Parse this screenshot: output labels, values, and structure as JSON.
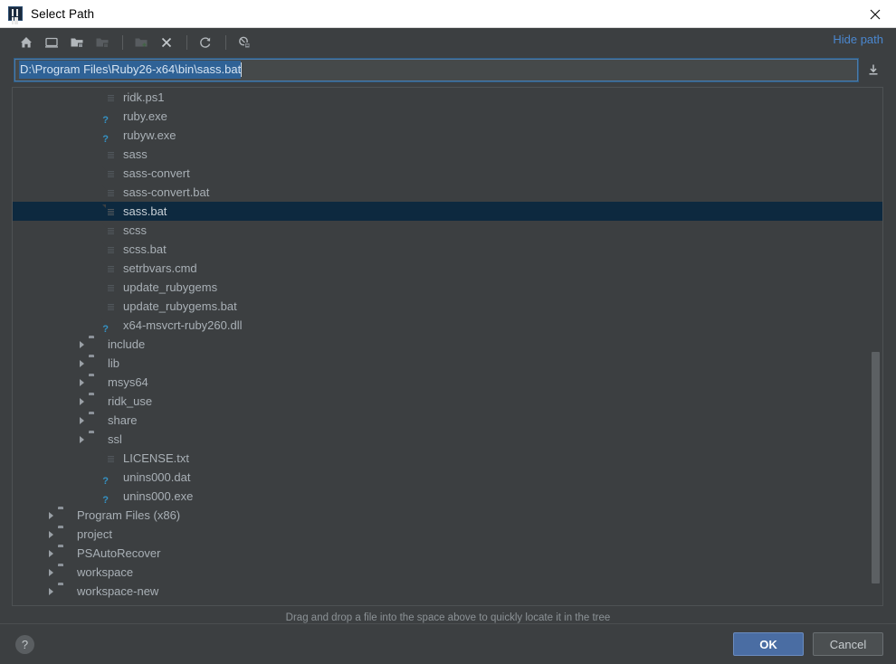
{
  "window": {
    "title": "Select Path",
    "app_icon": "intellij-idea-icon",
    "close_label": "×"
  },
  "toolbar": {
    "buttons": [
      {
        "name": "home-icon",
        "title": "Home",
        "enabled": true
      },
      {
        "name": "desktop-icon",
        "title": "Desktop",
        "enabled": true
      },
      {
        "name": "project-directory-icon",
        "title": "Project Directory",
        "enabled": true
      },
      {
        "name": "module-directory-icon",
        "title": "Module Directory",
        "enabled": false
      },
      {
        "name": "new-folder-icon",
        "title": "New Folder",
        "enabled": false
      },
      {
        "name": "delete-icon",
        "title": "Delete",
        "enabled": true
      },
      {
        "name": "refresh-icon",
        "title": "Refresh",
        "enabled": true
      },
      {
        "name": "show-hidden-files-icon",
        "title": "Show Hidden Files and Directories",
        "enabled": true
      }
    ],
    "hide_path_label": "Hide path"
  },
  "path_field": {
    "value": "D:\\Program Files\\Ruby26-x64\\bin\\sass.bat",
    "selected": true,
    "load_icon": "load-from-disk-icon"
  },
  "tree": {
    "rows": [
      {
        "indent": 5,
        "arrow": "none",
        "icon": "file",
        "label": "ridk.ps1",
        "selected": false
      },
      {
        "indent": 5,
        "arrow": "none",
        "icon": "unknown",
        "label": "ruby.exe",
        "selected": false
      },
      {
        "indent": 5,
        "arrow": "none",
        "icon": "unknown",
        "label": "rubyw.exe",
        "selected": false
      },
      {
        "indent": 5,
        "arrow": "none",
        "icon": "file",
        "label": "sass",
        "selected": false
      },
      {
        "indent": 5,
        "arrow": "none",
        "icon": "file",
        "label": "sass-convert",
        "selected": false
      },
      {
        "indent": 5,
        "arrow": "none",
        "icon": "file",
        "label": "sass-convert.bat",
        "selected": false
      },
      {
        "indent": 5,
        "arrow": "none",
        "icon": "file",
        "label": "sass.bat",
        "selected": true
      },
      {
        "indent": 5,
        "arrow": "none",
        "icon": "file",
        "label": "scss",
        "selected": false
      },
      {
        "indent": 5,
        "arrow": "none",
        "icon": "file",
        "label": "scss.bat",
        "selected": false
      },
      {
        "indent": 5,
        "arrow": "none",
        "icon": "file",
        "label": "setrbvars.cmd",
        "selected": false
      },
      {
        "indent": 5,
        "arrow": "none",
        "icon": "file",
        "label": "update_rubygems",
        "selected": false
      },
      {
        "indent": 5,
        "arrow": "none",
        "icon": "file",
        "label": "update_rubygems.bat",
        "selected": false
      },
      {
        "indent": 5,
        "arrow": "none",
        "icon": "unknown",
        "label": "x64-msvcrt-ruby260.dll",
        "selected": false
      },
      {
        "indent": 4,
        "arrow": "collapsed",
        "icon": "folder",
        "label": "include",
        "selected": false
      },
      {
        "indent": 4,
        "arrow": "collapsed",
        "icon": "folder",
        "label": "lib",
        "selected": false
      },
      {
        "indent": 4,
        "arrow": "collapsed",
        "icon": "folder",
        "label": "msys64",
        "selected": false
      },
      {
        "indent": 4,
        "arrow": "collapsed",
        "icon": "folder",
        "label": "ridk_use",
        "selected": false
      },
      {
        "indent": 4,
        "arrow": "collapsed",
        "icon": "folder",
        "label": "share",
        "selected": false
      },
      {
        "indent": 4,
        "arrow": "collapsed",
        "icon": "folder",
        "label": "ssl",
        "selected": false
      },
      {
        "indent": 5,
        "arrow": "none",
        "icon": "file",
        "label": "LICENSE.txt",
        "selected": false
      },
      {
        "indent": 5,
        "arrow": "none",
        "icon": "unknown",
        "label": "unins000.dat",
        "selected": false
      },
      {
        "indent": 5,
        "arrow": "none",
        "icon": "unknown",
        "label": "unins000.exe",
        "selected": false
      },
      {
        "indent": 2,
        "arrow": "collapsed",
        "icon": "folder",
        "label": "Program Files (x86)",
        "selected": false
      },
      {
        "indent": 2,
        "arrow": "collapsed",
        "icon": "folder",
        "label": "project",
        "selected": false
      },
      {
        "indent": 2,
        "arrow": "collapsed",
        "icon": "folder",
        "label": "PSAutoRecover",
        "selected": false
      },
      {
        "indent": 2,
        "arrow": "collapsed",
        "icon": "folder",
        "label": "workspace",
        "selected": false
      },
      {
        "indent": 2,
        "arrow": "collapsed",
        "icon": "folder",
        "label": "workspace-new",
        "selected": false
      }
    ],
    "scroll": {
      "thumb_top_pct": 51,
      "thumb_height_pct": 45
    }
  },
  "hint": "Drag and drop a file into the space above to quickly locate it in the tree",
  "footer": {
    "help_label": "?",
    "ok_label": "OK",
    "cancel_label": "Cancel"
  },
  "colors": {
    "accent_link": "#4a87cf",
    "selection_row": "#0d293f",
    "ok_button": "#4a6da3",
    "background": "#3c3f41"
  }
}
